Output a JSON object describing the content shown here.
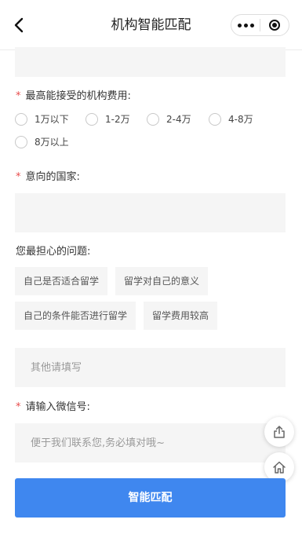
{
  "nav": {
    "title": "机构智能匹配",
    "icons": {
      "back": "chevron-left-icon",
      "more": "more-dots-icon",
      "close": "target-circle-icon"
    }
  },
  "fee_section": {
    "label": "最高能接受的机构费用:",
    "required_mark": "*",
    "options": [
      "1万以下",
      "1-2万",
      "2-4万",
      "4-8万",
      "8万以上"
    ]
  },
  "country_section": {
    "label": "意向的国家:",
    "required_mark": "*",
    "value": ""
  },
  "concern_section": {
    "label": "您最担心的问题:",
    "tags": [
      "自己是否适合留学",
      "留学对自己的意义",
      "自己的条件能否进行留学",
      "留学费用较高"
    ],
    "other_placeholder": "其他请填写"
  },
  "wechat_section": {
    "label": "请输入微信号:",
    "required_mark": "*",
    "placeholder": "便于我们联系您,务必填对哦~"
  },
  "floating": {
    "share_icon": "share-icon",
    "home_icon": "home-icon"
  },
  "submit_label": "智能匹配",
  "colors": {
    "accent": "#3f87ef",
    "required": "#e84c4c",
    "field_bg": "#f5f5f5"
  }
}
